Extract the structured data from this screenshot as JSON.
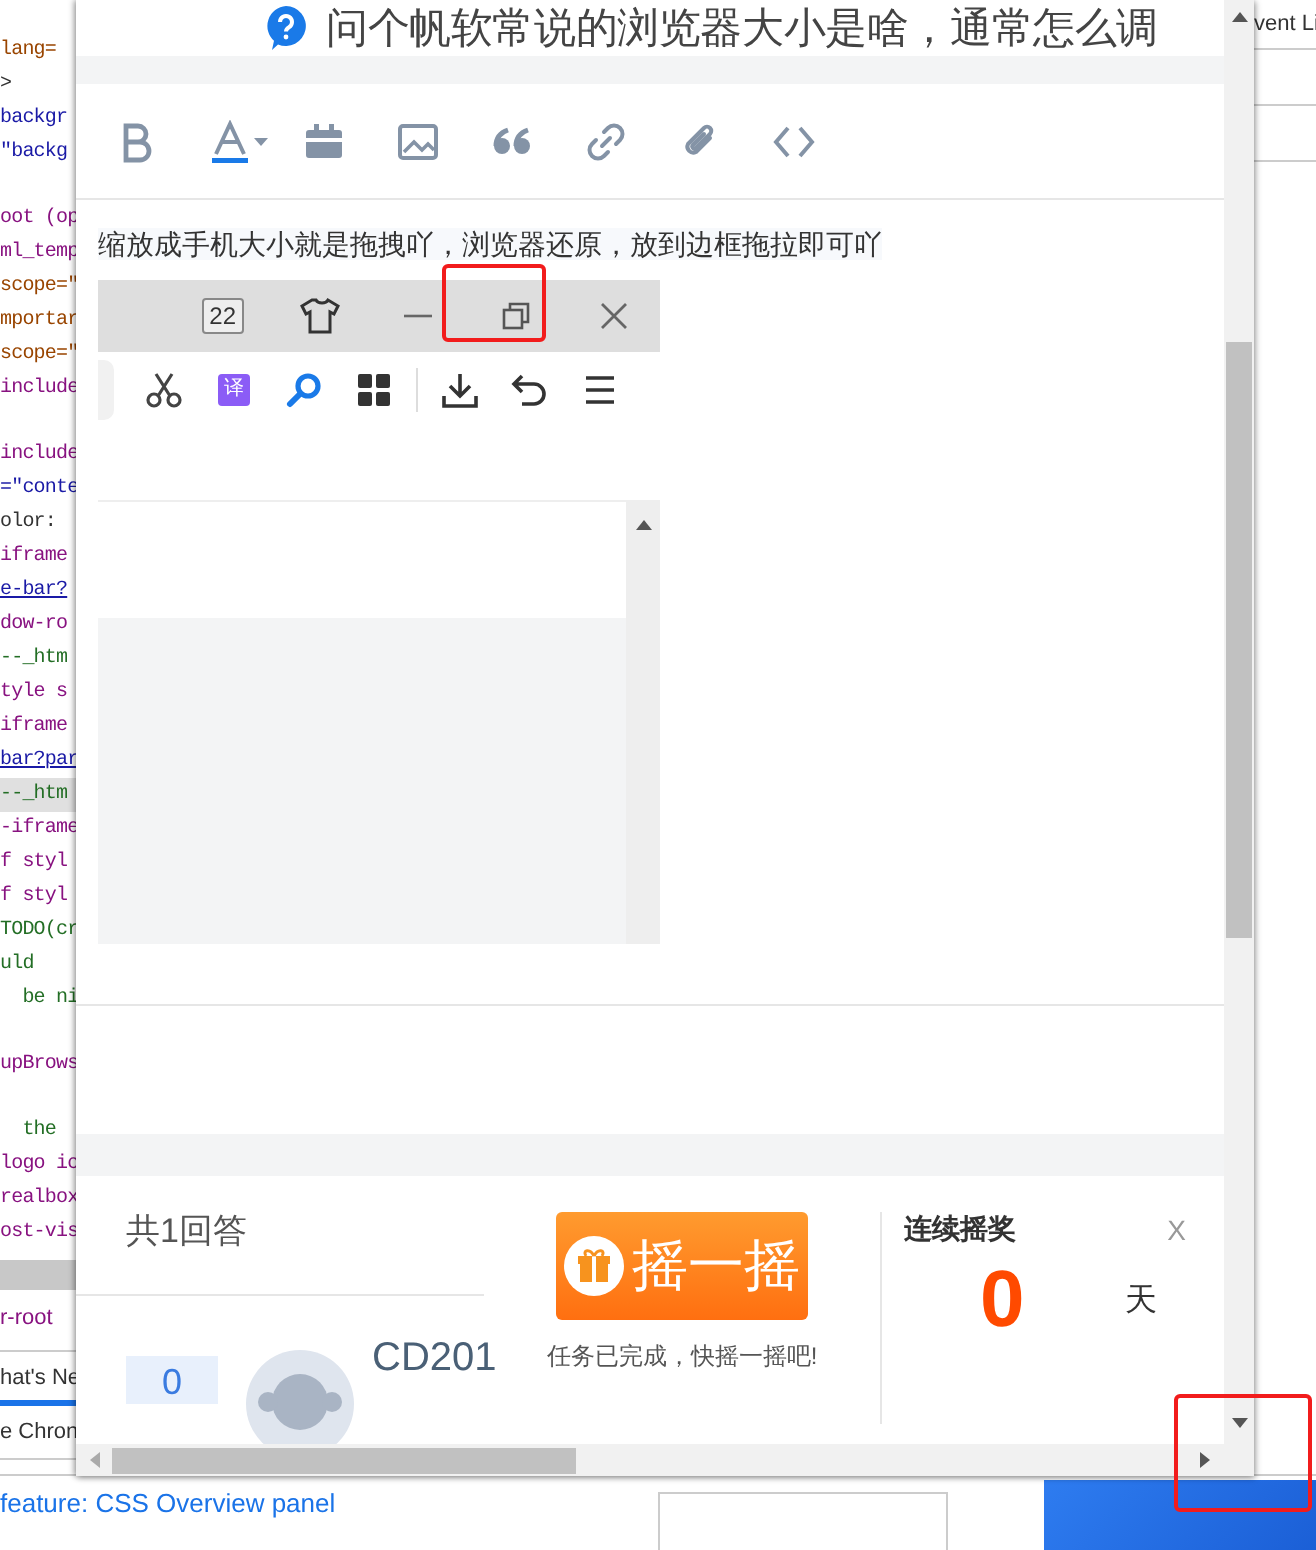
{
  "devtools": {
    "code_lines": [
      {
        "text": "lang=",
        "kind": "attr"
      },
      {
        "text": ">",
        "kind": "plain"
      },
      {
        "text": "backgr",
        "kind": "value"
      },
      {
        "text": "\"backg",
        "kind": "value"
      },
      {
        "kind": "blank"
      },
      {
        "text": "oot (op",
        "kind": "tag"
      },
      {
        "text": "ml_temp",
        "kind": "tag"
      },
      {
        "text": "scope=\"",
        "kind": "attr"
      },
      {
        "text": "mportar",
        "kind": "attr"
      },
      {
        "text": "scope=\"",
        "kind": "attr"
      },
      {
        "text": "include",
        "kind": "tag"
      },
      {
        "kind": "blank"
      },
      {
        "text": "include",
        "kind": "tag"
      },
      {
        "text": "=\"conte",
        "kind": "value"
      },
      {
        "text": "olor:",
        "kind": "plain"
      },
      {
        "text": "iframe",
        "kind": "tag"
      },
      {
        "text": "e-bar?",
        "kind": "link"
      },
      {
        "text": "dow-ro",
        "kind": "tag"
      },
      {
        "text": "--_htm",
        "kind": "comment"
      },
      {
        "text": "tyle s",
        "kind": "tag"
      },
      {
        "text": "iframe",
        "kind": "tag"
      },
      {
        "text": "bar?par",
        "kind": "link"
      },
      {
        "text": "--_htm",
        "kind": "comment-hl"
      },
      {
        "text": "-iframe",
        "kind": "tag"
      },
      {
        "text": "f styl",
        "kind": "tag"
      },
      {
        "text": "f styl",
        "kind": "tag"
      },
      {
        "text": "TODO(cr",
        "kind": "comment"
      },
      {
        "text": "uld",
        "kind": "comment"
      },
      {
        "text": "  be ni",
        "kind": "comment"
      },
      {
        "kind": "blank"
      },
      {
        "text": "upBrows",
        "kind": "tag"
      },
      {
        "kind": "blank"
      },
      {
        "text": "  the",
        "kind": "comment"
      },
      {
        "text": "logo ic",
        "kind": "tag"
      },
      {
        "text": "realbox",
        "kind": "tag"
      },
      {
        "text": "ost-vis",
        "kind": "tag"
      }
    ],
    "breadcrumb": "r-root",
    "drawer_tabs": [
      {
        "label": "hat's Ne",
        "selected": true
      },
      {
        "label": "e Chron",
        "selected": false
      }
    ],
    "news_link": "feature: CSS Overview panel",
    "side_tab": "vent Li"
  },
  "question_window": {
    "title": "问个帆软常说的浏览器大小是啥，通常怎么调",
    "answer_text": "缩放成手机大小就是拖拽吖，浏览器还原，放到边框拖拉即可吖",
    "screenshot": {
      "tab_count": "22",
      "translate_label": "译"
    },
    "answers": {
      "count_label": "共1回答",
      "vote_count": "0",
      "author": "CD201"
    },
    "lottery": {
      "button_label": "摇一摇",
      "hint": "任务已完成，快摇一摇吧!",
      "streak_title": "连续摇奖",
      "close": "X",
      "streak_days": "0",
      "day_unit": "天"
    }
  }
}
